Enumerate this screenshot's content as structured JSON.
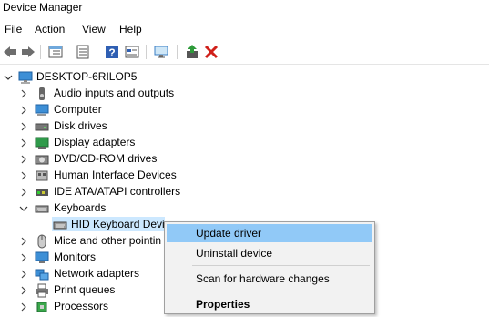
{
  "window": {
    "title": "Device Manager"
  },
  "menu": [
    "File",
    "Action",
    "View",
    "Help"
  ],
  "toolbar": {
    "buttons": [
      "back-icon",
      "forward-icon",
      "properties-grid-icon",
      "list-icon",
      "help-icon",
      "view-icon",
      "scan-icon",
      "update-driver-icon",
      "uninstall-icon"
    ]
  },
  "tree": {
    "root": "DESKTOP-6RILOP5",
    "items": [
      {
        "label": "Audio inputs and outputs",
        "icon": "speaker-icon"
      },
      {
        "label": "Computer",
        "icon": "computer-icon"
      },
      {
        "label": "Disk drives",
        "icon": "disk-icon"
      },
      {
        "label": "Display adapters",
        "icon": "display-icon"
      },
      {
        "label": "DVD/CD-ROM drives",
        "icon": "dvd-icon"
      },
      {
        "label": "Human Interface Devices",
        "icon": "hid-icon"
      },
      {
        "label": "IDE ATA/ATAPI controllers",
        "icon": "ide-icon"
      },
      {
        "label": "Keyboards",
        "icon": "keyboard-icon",
        "expanded": true
      },
      {
        "label": "HID Keyboard Devic",
        "icon": "keyboard-icon",
        "child": true,
        "selected": true
      },
      {
        "label": "Mice and other pointin",
        "icon": "mouse-icon"
      },
      {
        "label": "Monitors",
        "icon": "monitor-icon"
      },
      {
        "label": "Network adapters",
        "icon": "network-icon"
      },
      {
        "label": "Print queues",
        "icon": "printer-icon"
      },
      {
        "label": "Processors",
        "icon": "processor-icon"
      }
    ]
  },
  "context_menu": {
    "items": [
      {
        "label": "Update driver",
        "highlighted": true
      },
      {
        "label": "Uninstall device"
      },
      {
        "label": "Scan for hardware changes"
      },
      {
        "label": "Properties",
        "bold": true
      }
    ]
  },
  "colors": {
    "selection": "#cce8ff",
    "menu_highlight": "#91c9f7",
    "accent": "#1e7ad9"
  }
}
